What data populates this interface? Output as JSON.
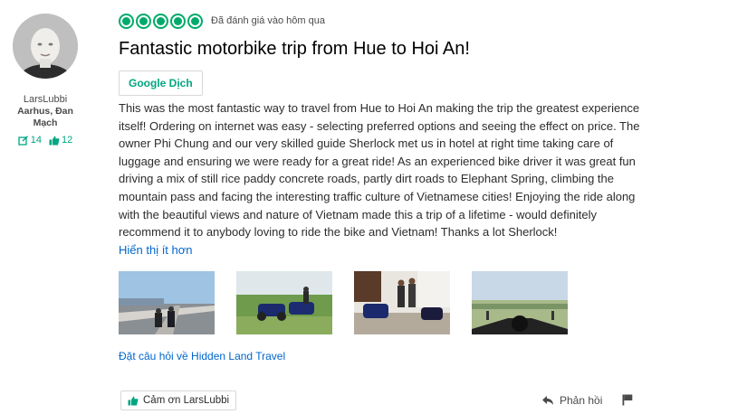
{
  "reviewer": {
    "username": "LarsLubbi",
    "location": "Aarhus, Đan Mạch",
    "contributions": "14",
    "helpful_votes": "12"
  },
  "review": {
    "rating": 5,
    "rating_date": "Đã đánh giá vào hôm qua",
    "title": "Fantastic motorbike trip from Hue to Hoi An!",
    "translate_label": "Google Dịch",
    "text": "This was the most fantastic way to travel from Hue to Hoi An making the trip the greatest experience itself! Ordering on internet was easy - selecting preferred options and seeing the effect on price. The owner Phi Chung and our very skilled guide Sherlock met us in hotel at right time taking care of luggage and ensuring we were ready for a great ride! As an experienced bike driver it was great fun driving a mix of still rice paddy concrete roads, partly dirt roads to Elephant Spring, climbing the mountain pass and facing the interesting traffic culture of Vietnamese cities! Enjoying the ride along with the beautiful views and nature of Vietnam made this a trip of a lifetime - would definitely recommend it to anybody loving to ride the bike and Vietnam! Thanks a lot Sherlock!",
    "show_less_label": "Hiển thị ít hơn",
    "ask_label": "Đặt câu hỏi về Hidden Land Travel",
    "thanks_label": "Cảm ơn LarsLubbi",
    "reply_label": "Phản hồi"
  },
  "colors": {
    "accent_green": "#00aa6c",
    "link_blue": "#0066cc"
  },
  "icons": [
    "review-count-icon",
    "thumbs-up-icon",
    "reply-arrow-icon",
    "flag-icon"
  ]
}
